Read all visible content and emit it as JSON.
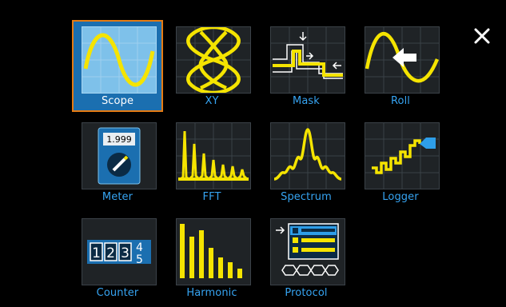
{
  "close_icon": "close-icon",
  "tiles": [
    {
      "label": "Scope",
      "icon": "sine-wave-icon",
      "selected": true
    },
    {
      "label": "XY",
      "icon": "lissajous-icon",
      "selected": false
    },
    {
      "label": "Mask",
      "icon": "mask-icon",
      "selected": false
    },
    {
      "label": "Roll",
      "icon": "roll-arrow-icon",
      "selected": false
    },
    {
      "label": "Meter",
      "icon": "multimeter-icon",
      "meter_reading": "1.999",
      "selected": false
    },
    {
      "label": "FFT",
      "icon": "fft-icon",
      "selected": false
    },
    {
      "label": "Spectrum",
      "icon": "spectrum-icon",
      "selected": false
    },
    {
      "label": "Logger",
      "icon": "logger-icon",
      "selected": false
    },
    {
      "label": "Counter",
      "icon": "counter-icon",
      "counter_digits": [
        "1",
        "2",
        "3",
        "4",
        "5"
      ],
      "selected": false
    },
    {
      "label": "Harmonic",
      "icon": "harmonic-bars-icon",
      "selected": false
    },
    {
      "label": "Protocol",
      "icon": "protocol-icon",
      "selected": false
    }
  ],
  "colors": {
    "background": "#000000",
    "label": "#36a4f2",
    "selected_fill": "#1b6fb0",
    "selected_border": "#e57b13",
    "trace": "#f5e400",
    "accent": "#2e9ee8"
  }
}
